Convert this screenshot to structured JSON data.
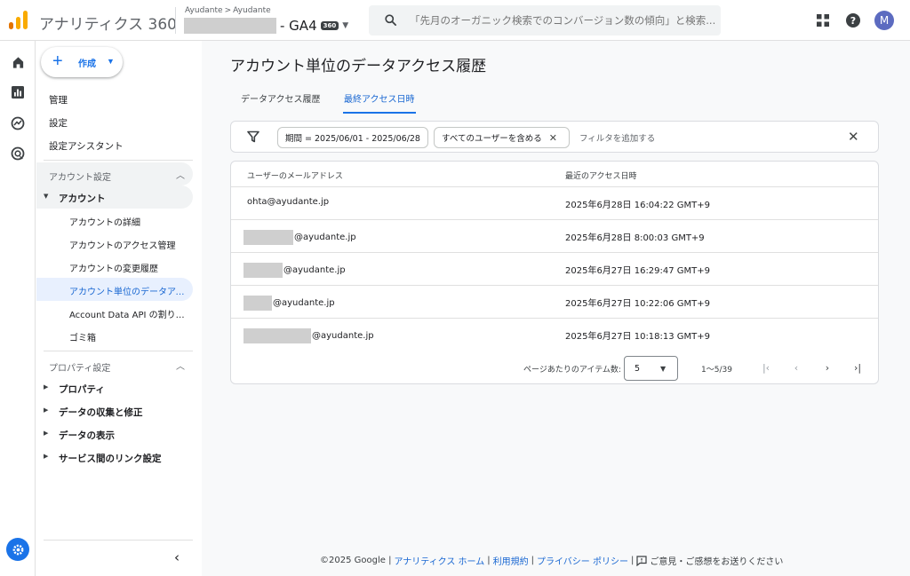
{
  "header": {
    "brand": "アナリティクス 360",
    "breadcrumb": {
      "account": "Ayudante",
      "sep": ">",
      "property": "Ayudante"
    },
    "property_name": "- GA4",
    "property_badge": "360",
    "search_placeholder": "「先月のオーガニック検索でのコンバージョン数の傾向」と検索...",
    "avatar_letter": "M"
  },
  "sidebar": {
    "create_label": "作成",
    "top_items": [
      "管理",
      "設定",
      "設定アシスタント"
    ],
    "account_section": {
      "title": "アカウント設定",
      "group": "アカウント",
      "items": [
        "アカウントの詳細",
        "アカウントのアクセス管理",
        "アカウントの変更履歴",
        "アカウント単位のデータアクセス履歴",
        "Account Data API の割り当て",
        "ゴミ箱"
      ]
    },
    "property_section": {
      "title": "プロパティ設定",
      "groups": [
        "プロパティ",
        "データの収集と修正",
        "データの表示",
        "サービス間のリンク設定"
      ]
    }
  },
  "main": {
    "title": "アカウント単位のデータアクセス履歴",
    "tabs": [
      "データアクセス履歴",
      "最終アクセス日時"
    ],
    "active_tab": 1,
    "filters": {
      "chips": [
        "期間 = 2025/06/01 - 2025/06/28",
        "すべてのユーザーを含める"
      ],
      "add_placeholder": "フィルタを追加する"
    },
    "table": {
      "columns": [
        "ユーザーのメールアドレス",
        "最近のアクセス日時"
      ],
      "rows": [
        {
          "email": "ohta@ayudante.jp",
          "time": "2025年6月28日 16:04:22 GMT+9"
        },
        {
          "email": "@ayudante.jp",
          "time": "2025年6月28日 8:00:03 GMT+9"
        },
        {
          "email": "@ayudante.jp",
          "time": "2025年6月27日 16:29:47 GMT+9"
        },
        {
          "email": "@ayudante.jp",
          "time": "2025年6月27日 10:22:06 GMT+9"
        },
        {
          "email": "@ayudante.jp",
          "time": "2025年6月27日 10:18:13 GMT+9"
        }
      ]
    },
    "pagination": {
      "label": "ページあたりのアイテム数:",
      "page_size": "5",
      "range": "1～5/39"
    }
  },
  "footer": {
    "copyright": "©2025 Google |",
    "links": [
      "アナリティクス ホーム",
      "利用規約",
      "プライバシー ポリシー"
    ],
    "sep": "|",
    "feedback": "ご意見・ご感想をお送りください"
  },
  "colors": {
    "accent": "#1a73e8",
    "active_bg": "#e8f0fe",
    "logo_orange": "#f9ab00",
    "logo_dark": "#e37400"
  }
}
